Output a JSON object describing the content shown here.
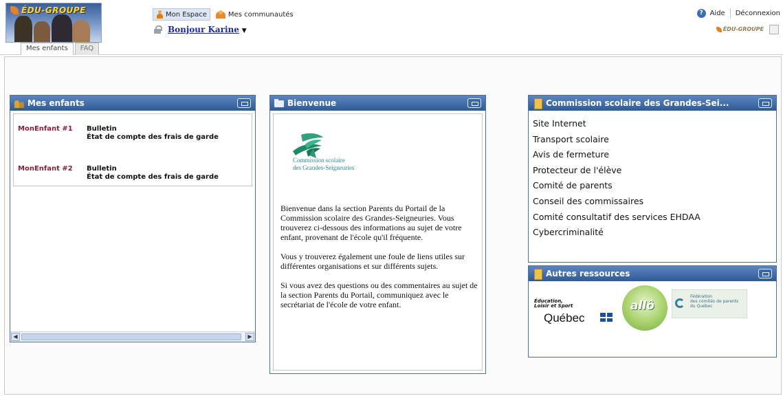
{
  "header": {
    "brand": "ÉDU-GROUPE",
    "brand_small": "ÉDU-GROUPE",
    "tabs": [
      {
        "label": "Mes enfants"
      },
      {
        "label": "FAQ"
      }
    ],
    "nav": {
      "mon_espace": "Mon Espace",
      "communautes": "Mes communautés"
    },
    "greeting": "Bonjour Karine",
    "aide": "Aide",
    "deconnexion": "Déconnexion"
  },
  "panels": {
    "mes_enfants": {
      "title": "Mes enfants",
      "children": [
        {
          "name": "MonEnfant #1",
          "link1": "Bulletin",
          "link2": "État de compte des frais de garde"
        },
        {
          "name": "MonEnfant #2",
          "link1": "Bulletin",
          "link2": "État de compte des frais de garde"
        }
      ]
    },
    "bienvenue": {
      "title": "Bienvenue",
      "logo_line1": "Commission scolaire",
      "logo_line2": "des Grandes-Seigneuries",
      "paragraphs": [
        "Bienvenue dans la section Parents du Portail de la Commission scolaire des Grandes-Seigneuries. Vous trouverez ci-dessous des informations au sujet de votre enfant, provenant de l'école qu'il fréquente.",
        "Vous y trouverez également une foule de liens utiles sur différentes organisations et sur différents sujets.",
        "Si vous avez des questions ou des commentaires au sujet de la section Parents du Portail, communiquez avec le secrétariat de l'école de votre enfant."
      ]
    },
    "commission": {
      "title": "Commission scolaire des Grandes-Sei...",
      "links": [
        "Site Internet",
        "Transport scolaire",
        "Avis de fermeture",
        "Protecteur de l'élève",
        "Comité de parents",
        "Conseil des commissaires",
        "Comité consultatif des services EHDAA",
        "Cybercriminalité"
      ]
    },
    "ressources": {
      "title": "Autres ressources",
      "qc_line1": "Éducation,",
      "qc_line2": "Loisir et Sport",
      "qc_word": "Québec",
      "allo": "allô",
      "fed_line1": "Fédération",
      "fed_line2": "des comités de parents",
      "fed_line3": "du Québec"
    }
  }
}
